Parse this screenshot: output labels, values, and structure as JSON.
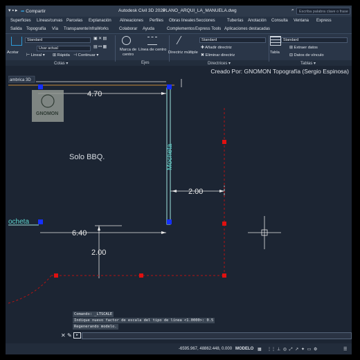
{
  "title_bar": {
    "share": "Compartir",
    "app": "Autodesk Civil 3D 2026",
    "file": "PLANO_ARQUI_LA_MANUELA.dwg",
    "search_placeholder": "Escriba palabra clave o frase"
  },
  "ribbon_tabs_row1": [
    "Superficies",
    "Líneas/curvas",
    "Parcelas",
    "Explanación",
    "Alineaciones",
    "Perfiles",
    "Obras lineales",
    "Secciones",
    "Tuberías",
    "Anotación",
    "Consulta",
    "Ventana",
    "Express"
  ],
  "ribbon_tabs_row2": [
    "Salida",
    "Topografía",
    "Vía",
    "Transparente",
    "InfraWorks",
    "Colaborar",
    "Ayuda",
    "Complementos",
    "Express Tools",
    "Aplicaciones destacadas"
  ],
  "ribbon": {
    "cotas": {
      "style": "Standard",
      "layer": "Usar actual",
      "linear": "Lineal",
      "quick": "Rápida",
      "continue": "Continuar",
      "label": "Cotas"
    },
    "ejes": {
      "center_mark": "Marca de centro",
      "center_line": "Línea de centro",
      "label": "Ejes"
    },
    "directrices": {
      "multileader": "Directriz múltiple",
      "style": "Standard",
      "add": "Añadir directriz",
      "remove": "Eliminar directriz",
      "label": "Directrices"
    },
    "tablas": {
      "table": "Tabla",
      "style": "Standard",
      "extract": "Extraer datos",
      "link": "Datos de vínculo",
      "label": "Tablas"
    },
    "acotar": "Acotar"
  },
  "drawing": {
    "credit": "Creado Por: GNOMON Topografía (Sergio Espinosa)",
    "corner_label": "ambrica 3D",
    "logo_text": "GNOMON",
    "room_label": "Solo  BBQ.",
    "mocheta_vertical": "Mocheta",
    "mocheta_left": "ocheta",
    "dim_top": "4.70",
    "dim_right": "2.00",
    "dim_left": "6.40",
    "dim_vertical": "2.00"
  },
  "command": {
    "history": [
      "Comando: _LTSCALE",
      "Indique nuevo factor de escala del tipo de línea <1.0000>: 0.5",
      "Regenerando modelo."
    ]
  },
  "status_bar": {
    "coords": "-6595.967, 48862.448, 0.000",
    "mode": "MODELO"
  },
  "colors": {
    "accent": "#2f9bd7",
    "grip_blue": "#1530ff",
    "grip_red": "#e01010",
    "dim_white": "#e8e8e8",
    "wall_cyan": "#9fe6e2",
    "dashed_red": "#b31313"
  }
}
